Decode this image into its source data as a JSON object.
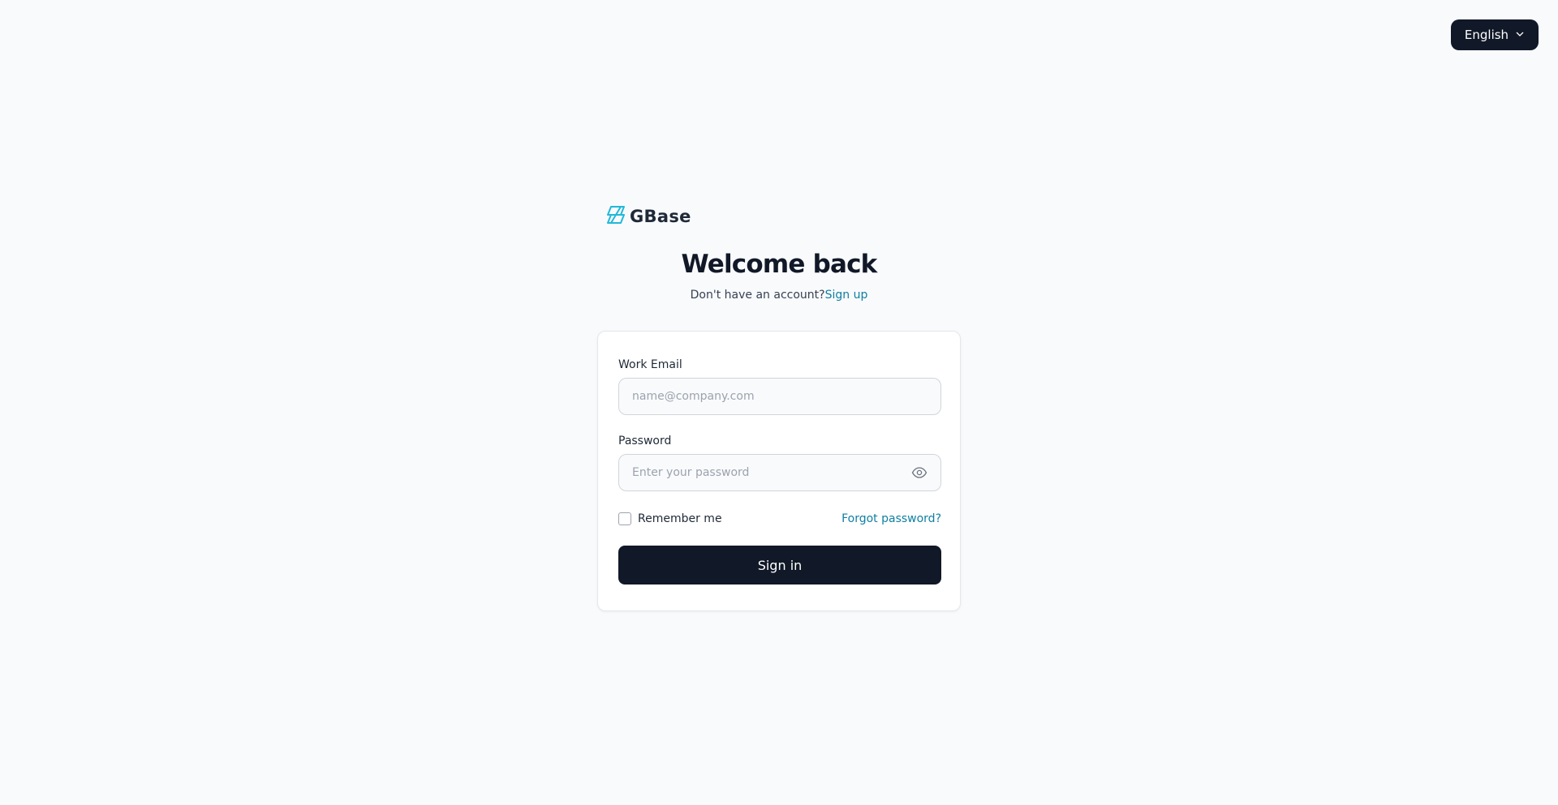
{
  "language": {
    "label": "English",
    "icon": "chevron-down-icon"
  },
  "brand": {
    "name": "GBase",
    "icon": "gbase-logo-icon",
    "accent": "#22b8d9"
  },
  "header": {
    "title": "Welcome back",
    "no_account_text": "Don't have an account?",
    "signup_label": "Sign up"
  },
  "form": {
    "email_label": "Work Email",
    "email_placeholder": "name@company.com",
    "email_value": "",
    "password_label": "Password",
    "password_placeholder": "Enter your password",
    "password_value": "",
    "password_toggle_icon": "eye-icon",
    "remember_label": "Remember me",
    "remember_checked": false,
    "forgot_label": "Forgot password?",
    "submit_label": "Sign in"
  },
  "colors": {
    "background": "#f8fafc",
    "primary": "#111827",
    "link": "#0e7fa3"
  }
}
